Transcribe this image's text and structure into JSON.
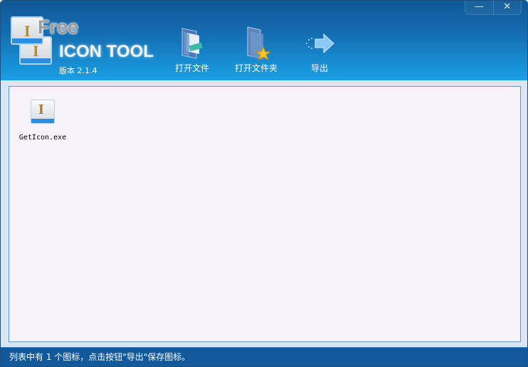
{
  "window": {
    "minimize": "—",
    "close": "✕"
  },
  "logo": {
    "free": "Free",
    "icon_tool": "ICON TOOL",
    "version": "版本 2.1.4"
  },
  "toolbar": [
    {
      "label": "打开文件",
      "icon": "open-file-icon"
    },
    {
      "label": "打开文件夹",
      "icon": "open-folder-icon"
    },
    {
      "label": "导出",
      "icon": "export-arrow-icon"
    }
  ],
  "files": [
    {
      "name": "GetIcon.exe"
    }
  ],
  "status": "列表中有 1 个图标，点击按钮\"导出\"保存图标。"
}
